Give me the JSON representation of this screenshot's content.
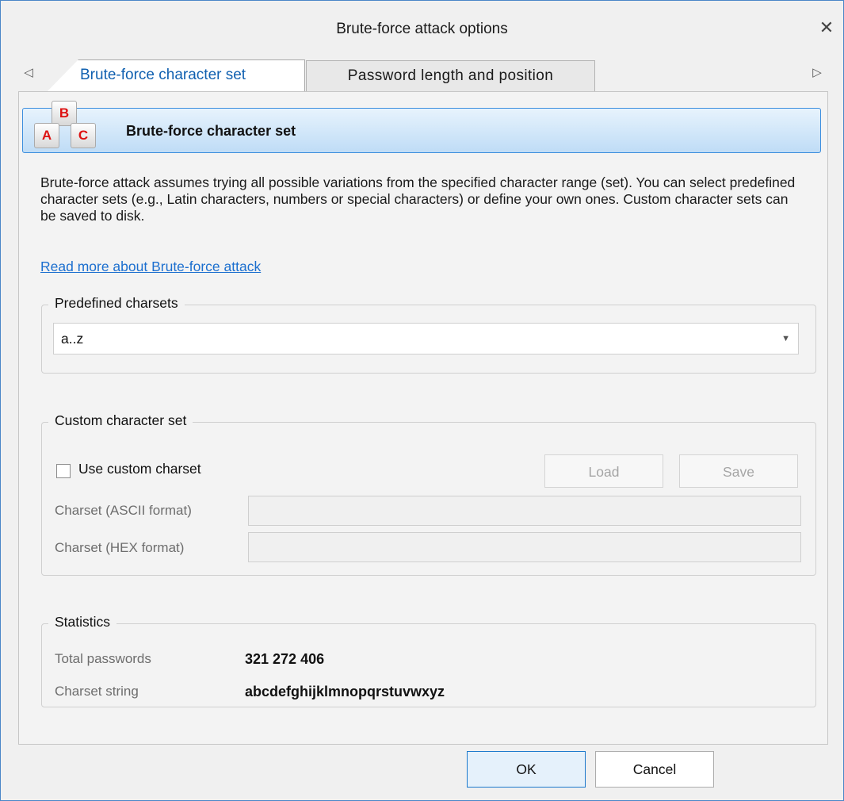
{
  "window": {
    "title": "Brute-force attack options",
    "close_symbol": "✕"
  },
  "tabs": {
    "scroll_left": "◁",
    "scroll_right": "▷",
    "items": [
      {
        "label": "Brute-force character set",
        "active": true
      },
      {
        "label": "Password length and position",
        "active": false
      }
    ]
  },
  "banner": {
    "title": "Brute-force character set",
    "icon": "abc-keys-icon",
    "keys": [
      "B",
      "A",
      "C"
    ]
  },
  "description": "Brute-force attack assumes trying all possible variations from the specified character range (set). You can select predefined character sets (e.g., Latin characters, numbers or special characters) or define your own ones. Custom character sets can be saved to disk.",
  "read_more": "Read more about Brute-force attack",
  "predefined": {
    "title": "Predefined charsets",
    "selected": "a..z"
  },
  "custom": {
    "title": "Custom character set",
    "checkbox_label": "Use custom charset",
    "checked": false,
    "load_label": "Load",
    "save_label": "Save",
    "ascii_label": "Charset (ASCII format)",
    "ascii_value": "",
    "hex_label": "Charset (HEX format)",
    "hex_value": ""
  },
  "statistics": {
    "title": "Statistics",
    "total_label": "Total passwords",
    "total_value": "321 272 406",
    "charset_label": "Charset string",
    "charset_value": "abcdefghijklmnopqrstuvwxyz"
  },
  "footer": {
    "ok_label": "OK",
    "cancel_label": "Cancel"
  },
  "colors": {
    "accent": "#3c8ede",
    "link": "#1c6fcf",
    "tab_active_text": "#1060b0",
    "key_letter": "#dd1111"
  }
}
